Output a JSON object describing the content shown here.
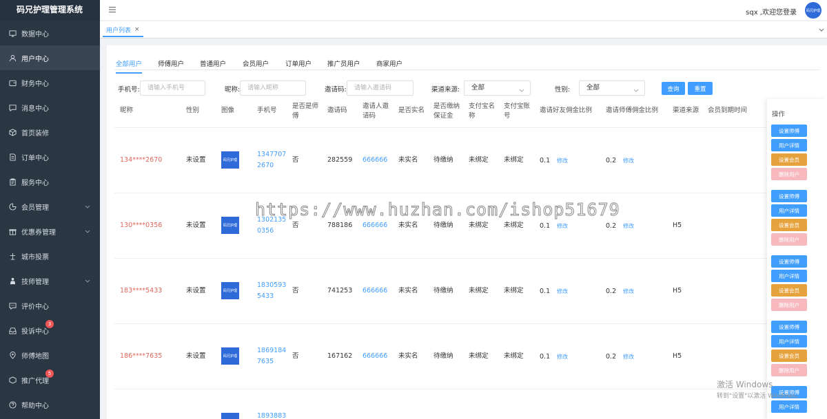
{
  "app": {
    "title": "码兄护理管理系统"
  },
  "sidebar": {
    "items": [
      {
        "label": "数据中心",
        "icon": "monitor-icon"
      },
      {
        "label": "用户中心",
        "icon": "user-icon",
        "active": true
      },
      {
        "label": "财务中心",
        "icon": "wallet-icon"
      },
      {
        "label": "消息中心",
        "icon": "message-icon"
      },
      {
        "label": "首页装修",
        "icon": "cube-icon"
      },
      {
        "label": "订单中心",
        "icon": "document-icon"
      },
      {
        "label": "服务中心",
        "icon": "clipboard-icon"
      },
      {
        "label": "会员管理",
        "icon": "pie-icon",
        "expandable": true
      },
      {
        "label": "优惠券管理",
        "icon": "gift-icon",
        "expandable": true
      },
      {
        "label": "城市投票",
        "icon": "vote-icon"
      },
      {
        "label": "技师管理",
        "icon": "person-icon",
        "expandable": true
      },
      {
        "label": "评价中心",
        "icon": "comment-icon"
      },
      {
        "label": "投诉中心",
        "icon": "inbox-icon",
        "badge": "3"
      },
      {
        "label": "师傅地图",
        "icon": "location-icon"
      },
      {
        "label": "推广代理",
        "icon": "box-icon",
        "badge": "5"
      },
      {
        "label": "帮助中心",
        "icon": "help-icon"
      }
    ]
  },
  "header": {
    "greeting": "sqx ,欢迎您登录",
    "avatar_text": "码兄护理"
  },
  "tagbar": {
    "tag": "用户列表"
  },
  "tabs": [
    "全部用户",
    "师傅用户",
    "普通用户",
    "会员用户",
    "订单用户",
    "推广员用户",
    "商家用户"
  ],
  "filters": {
    "phone_label": "手机号:",
    "phone_placeholder": "请输入手机号",
    "nick_label": "昵称:",
    "nick_placeholder": "请输入昵称",
    "code_label": "邀请码:",
    "code_placeholder": "请输入邀请码",
    "channel_label": "渠道来源:",
    "channel_value": "全部",
    "gender_label": "性别:",
    "gender_value": "全部",
    "query_button": "查询",
    "reset_button": "重置"
  },
  "table": {
    "headers": {
      "nickname": "昵称",
      "gender": "性别",
      "image": "图像",
      "phone": "手机号",
      "is_master_1": "是否是师",
      "is_master_2": "傅",
      "invite_code": "邀请码",
      "inviter_1": "邀请人邀",
      "inviter_2": "请码",
      "realname": "是否实名",
      "deposit_1": "是否缴纳",
      "deposit_2": "保证金",
      "alipay_name_1": "支付宝名",
      "alipay_name_2": "称",
      "alipay_acc_1": "支付宝账",
      "alipay_acc_2": "号",
      "friend_ratio": "邀请好友佣金比例",
      "master_ratio": "邀请师傅佣金比例",
      "channel": "渠道来源",
      "member_expire": "会员到期时间",
      "ops": "操作"
    },
    "image_text": "码兄护理",
    "edit_label": "修改",
    "rows": [
      {
        "nickname": "134****2670",
        "gender": "未设置",
        "phone_1": "1347707",
        "phone_2": "2670",
        "is_master": "否",
        "invite_code": "282559",
        "inviter_code": "666666",
        "realname": "未实名",
        "deposit": "待缴纳",
        "alipay_name": "未绑定",
        "alipay_account": "未绑定",
        "friend_ratio": "0.1",
        "master_ratio": "0.2",
        "channel": ""
      },
      {
        "nickname": "130****0356",
        "gender": "未设置",
        "phone_1": "1302135",
        "phone_2": "0356",
        "is_master": "否",
        "invite_code": "788186",
        "inviter_code": "666666",
        "realname": "未实名",
        "deposit": "待缴纳",
        "alipay_name": "未绑定",
        "alipay_account": "未绑定",
        "friend_ratio": "0.1",
        "master_ratio": "0.2",
        "channel": "H5"
      },
      {
        "nickname": "183****5433",
        "gender": "未设置",
        "phone_1": "1830593",
        "phone_2": "5433",
        "is_master": "否",
        "invite_code": "741253",
        "inviter_code": "666666",
        "realname": "未实名",
        "deposit": "待缴纳",
        "alipay_name": "未绑定",
        "alipay_account": "未绑定",
        "friend_ratio": "0.1",
        "master_ratio": "0.2",
        "channel": "H5"
      },
      {
        "nickname": "186****7635",
        "gender": "未设置",
        "phone_1": "1869184",
        "phone_2": "7635",
        "is_master": "否",
        "invite_code": "167162",
        "inviter_code": "666666",
        "realname": "未实名",
        "deposit": "待缴纳",
        "alipay_name": "未绑定",
        "alipay_account": "未绑定",
        "friend_ratio": "0.1",
        "master_ratio": "0.2",
        "channel": "H5"
      },
      {
        "nickname": "",
        "gender": "",
        "phone_1": "1893883",
        "phone_2": "",
        "is_master": "",
        "invite_code": "",
        "inviter_code": "",
        "realname": "",
        "deposit": "",
        "alipay_name": "",
        "alipay_account": "",
        "friend_ratio": "",
        "master_ratio": "",
        "channel": ""
      }
    ],
    "ops_buttons": [
      "设置师傅",
      "用户详情",
      "设置会员",
      "删除用户"
    ]
  },
  "watermark": "https://www.huzhan.com/ishop51679",
  "os_notice": {
    "title": "激活 Windows",
    "subtitle": "转到\"设置\"以激活 Windows。"
  },
  "colors": {
    "sidebar": "#2b3643",
    "accent": "#409eff",
    "nickname": "#e0665c",
    "orange": "#e6a23c",
    "danger_light": "#f7b9be"
  }
}
